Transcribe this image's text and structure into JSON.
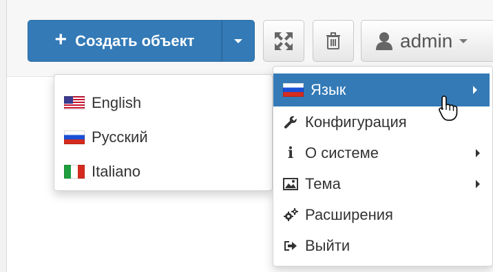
{
  "toolbar": {
    "create_label": "Создать объект",
    "user_label": "admin",
    "icons": {
      "plus": "plus-icon",
      "expand": "expand-icon",
      "trash": "trash-icon",
      "user": "user-icon"
    }
  },
  "language_menu": {
    "items": [
      {
        "label": "English",
        "flag": "us-flag-icon"
      },
      {
        "label": "Русский",
        "flag": "ru-flag-icon"
      },
      {
        "label": "Italiano",
        "flag": "it-flag-icon"
      }
    ]
  },
  "user_menu": {
    "items": [
      {
        "label": "Язык",
        "icon": "ru-flag-icon",
        "submenu": true,
        "active": true
      },
      {
        "label": "Конфигурация",
        "icon": "wrench-icon",
        "submenu": false
      },
      {
        "label": "О системе",
        "icon": "info-icon",
        "submenu": true
      },
      {
        "label": "Тема",
        "icon": "image-icon",
        "submenu": true
      },
      {
        "label": "Расширения",
        "icon": "cogs-icon",
        "submenu": false
      },
      {
        "label": "Выйти",
        "icon": "logout-icon",
        "submenu": false
      }
    ]
  },
  "colors": {
    "primary": "#337ab7",
    "primary_border": "#2e6da4",
    "text": "#333333"
  }
}
